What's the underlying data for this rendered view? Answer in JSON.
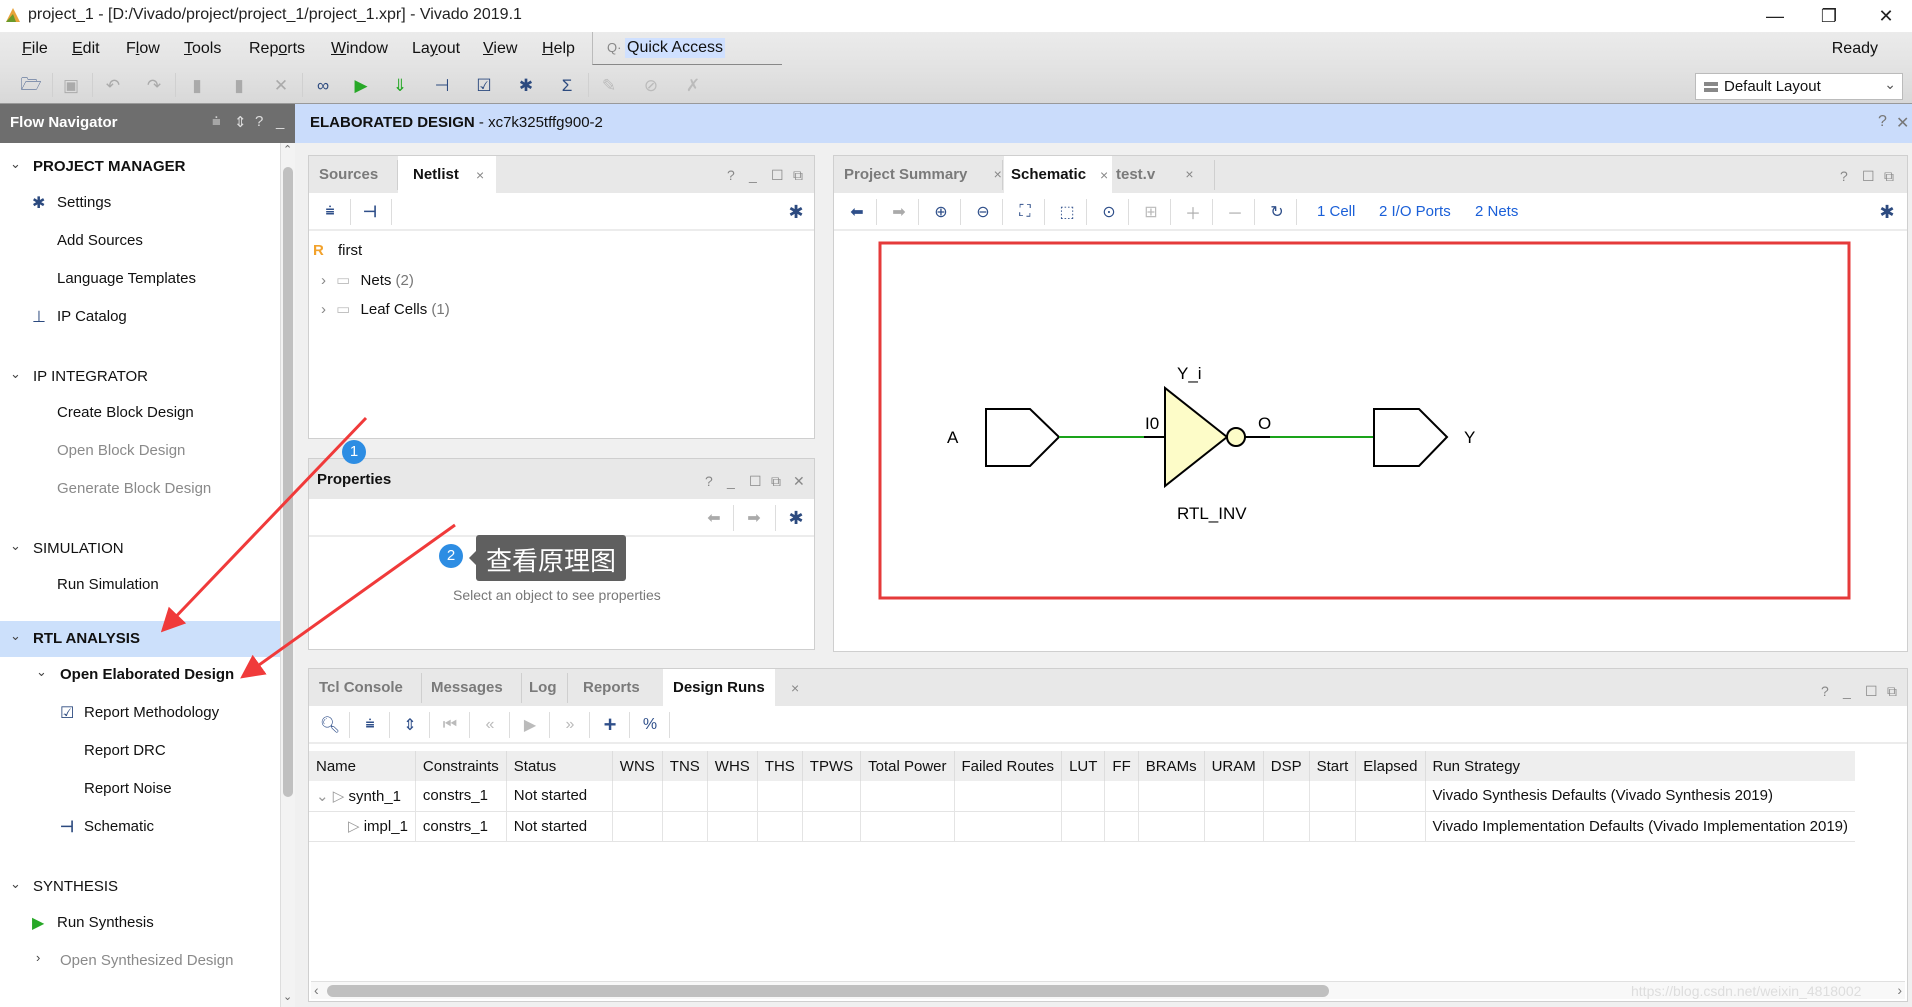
{
  "window": {
    "title": "project_1 - [D:/Vivado/project/project_1/project_1.xpr] - Vivado 2019.1",
    "minimize": "—",
    "restore": "❐",
    "close": "✕"
  },
  "menubar": {
    "items": [
      {
        "label": "File",
        "mnemonic": "F",
        "rest": "ile"
      },
      {
        "label": "Edit",
        "mnemonic": "E",
        "rest": "dit"
      },
      {
        "label": "Flow",
        "pre": "F",
        "mnemonic": "l",
        "rest": "ow"
      },
      {
        "label": "Tools",
        "mnemonic": "T",
        "rest": "ools"
      },
      {
        "label": "Reports",
        "pre": "Rep",
        "mnemonic": "o",
        "rest": "rts"
      },
      {
        "label": "Window",
        "mnemonic": "W",
        "rest": "indow"
      },
      {
        "label": "Layout",
        "pre": "La",
        "mnemonic": "y",
        "rest": "out"
      },
      {
        "label": "View",
        "mnemonic": "V",
        "rest": "iew"
      },
      {
        "label": "Help",
        "mnemonic": "H",
        "rest": "elp"
      }
    ],
    "quick_access": "Quick Access",
    "status": "Ready"
  },
  "toolbar": {
    "buttons": [
      "open-project",
      "save",
      "undo",
      "redo",
      "copy",
      "paste",
      "delete",
      "find",
      "run",
      "generate-bitstream",
      "schematic",
      "report",
      "settings",
      "sigma",
      "disabled-1",
      "disabled-2",
      "disabled-3"
    ],
    "layout_select": "Default Layout"
  },
  "flow_navigator": {
    "title": "Flow Navigator",
    "sections": [
      {
        "label": "PROJECT MANAGER",
        "bold": true,
        "items": [
          "Settings",
          "Add Sources",
          "Language Templates",
          "IP Catalog"
        ]
      },
      {
        "label": "IP INTEGRATOR",
        "items": [
          "Create Block Design",
          "Open Block Design",
          "Generate Block Design"
        ]
      },
      {
        "label": "SIMULATION",
        "items": [
          "Run Simulation"
        ]
      },
      {
        "label": "RTL ANALYSIS",
        "bold": true,
        "selected": true,
        "sub_header": "Open Elaborated Design",
        "items": [
          "Report Methodology",
          "Report DRC",
          "Report Noise",
          "Schematic"
        ]
      },
      {
        "label": "SYNTHESIS",
        "items": [
          "Run Synthesis",
          "Open Synthesized Design"
        ]
      }
    ]
  },
  "main_header": {
    "title": "ELABORATED DESIGN",
    "part": " - xc7k325tffg900-2"
  },
  "netlist_panel": {
    "tabs": [
      "Sources",
      "Netlist"
    ],
    "active_tab": "Netlist",
    "root": "first",
    "root_icon": "R",
    "items": [
      {
        "label": "Nets",
        "count": "(2)"
      },
      {
        "label": "Leaf Cells",
        "count": "(1)"
      }
    ]
  },
  "properties_panel": {
    "title": "Properties",
    "empty_text": "Select an object to see properties"
  },
  "schematic_panel": {
    "tabs": [
      "Project Summary",
      "Schematic",
      "test.v"
    ],
    "active_tab": "Schematic",
    "stats": [
      "1 Cell",
      "2 I/O Ports",
      "2 Nets"
    ],
    "diagram": {
      "input_port": "A",
      "output_port": "Y",
      "cell_name": "Y_i",
      "cell_type": "RTL_INV",
      "input_pin": "I0",
      "output_pin": "O"
    },
    "colors": {
      "net": "#1aa31a",
      "cell_fill": "#fdfcc8",
      "highlight_box": "#e53a3a"
    }
  },
  "bottom_panel": {
    "tabs": [
      "Tcl Console",
      "Messages",
      "Log",
      "Reports",
      "Design Runs"
    ],
    "active_tab": "Design Runs",
    "columns": [
      "Name",
      "Constraints",
      "Status",
      "WNS",
      "TNS",
      "WHS",
      "THS",
      "TPWS",
      "Total Power",
      "Failed Routes",
      "LUT",
      "FF",
      "BRAMs",
      "URAM",
      "DSP",
      "Start",
      "Elapsed",
      "Run Strategy"
    ],
    "rows": [
      {
        "name": "synth_1",
        "constraints": "constrs_1",
        "status": "Not started",
        "strategy": "Vivado Synthesis Defaults (Vivado Synthesis 2019)"
      },
      {
        "name": "impl_1",
        "constraints": "constrs_1",
        "status": "Not started",
        "strategy": "Vivado Implementation Defaults (Vivado Implementation 2019)"
      }
    ],
    "watermark": "https://blog.csdn.net/weixin_4818002"
  },
  "annotations": {
    "badge1": "1",
    "badge2": "2",
    "callout": "查看原理图",
    "arrow_color": "#f03a3a",
    "badge_color": "#2d8de3"
  }
}
